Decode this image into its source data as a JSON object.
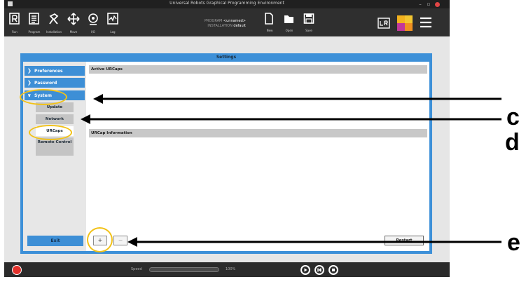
{
  "window": {
    "title": "Universal Robots Graphical Programming Environment"
  },
  "header": {
    "nav_buttons": [
      {
        "label": "Run",
        "icon": "run-icon"
      },
      {
        "label": "Program",
        "icon": "program-icon"
      },
      {
        "label": "Installation",
        "icon": "installation-icon"
      },
      {
        "label": "Move",
        "icon": "move-icon"
      },
      {
        "label": "I/O",
        "icon": "io-icon"
      },
      {
        "label": "Log",
        "icon": "log-icon"
      }
    ],
    "program_label": "PROGRAM",
    "program_value": "<unnamed>",
    "installation_label": "INSTALLATION",
    "installation_value": "default",
    "file_buttons": [
      {
        "label": "New",
        "icon": "new-file-icon"
      },
      {
        "label": "Open",
        "icon": "open-folder-icon"
      },
      {
        "label": "Save",
        "icon": "save-icon"
      }
    ],
    "right_icons": [
      "urcaps-icon",
      "ur-logo-icon",
      "hamburger-menu-icon"
    ]
  },
  "settings": {
    "title": "Settings",
    "sidebar": {
      "items": [
        {
          "label": "Preferences",
          "expanded": false
        },
        {
          "label": "Password",
          "expanded": false
        },
        {
          "label": "System",
          "expanded": true
        }
      ],
      "subitems": [
        {
          "label": "Update"
        },
        {
          "label": "Network"
        },
        {
          "label": "URCaps",
          "selected": true
        },
        {
          "label": "Remote Control"
        }
      ],
      "exit_label": "Exit"
    },
    "main": {
      "active_urcaps_header": "Active URCaps",
      "urcap_info_header": "URCap Information",
      "add_label": "+",
      "remove_label": "−",
      "restart_label": "Restart"
    }
  },
  "footer": {
    "speed_label": "Speed",
    "speed_value": "100%",
    "speed_percent": 100,
    "controls": [
      "play-icon",
      "step-icon",
      "stop-icon"
    ]
  },
  "annotations": {
    "labels": [
      "c",
      "d",
      "e"
    ],
    "highlight_color": "#f2c218"
  }
}
